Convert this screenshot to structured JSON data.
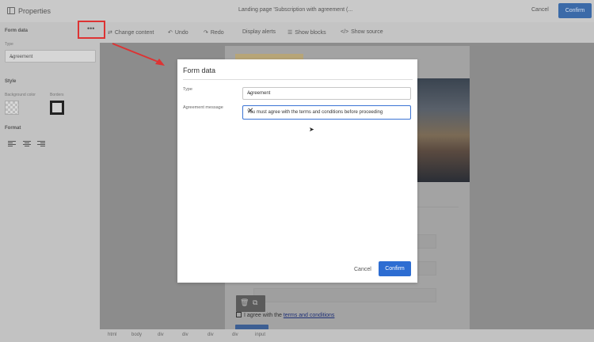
{
  "topbar": {
    "props_title": "Properties",
    "page_title": "Landing page 'Subscription with agreement (...",
    "cancel": "Cancel",
    "confirm": "Confirm"
  },
  "left_panel": {
    "form_data": "Form data",
    "type_label": "Type",
    "type_value": "Agreement",
    "style": "Style",
    "bg_color": "Background color",
    "borders": "Borders",
    "format": "Format"
  },
  "more_button": "•••",
  "toolbar": {
    "change_content": "Change content",
    "undo": "Undo",
    "redo": "Redo",
    "display_alerts": "Display alerts",
    "show_blocks": "Show blocks",
    "show_source": "Show source"
  },
  "page": {
    "agree_prefix": "I agree with the",
    "agree_link": "terms and conditions"
  },
  "breadcrumb": [
    "html",
    "body",
    "div",
    "div",
    "div",
    "div",
    "input"
  ],
  "modal": {
    "title": "Form data",
    "type_label": "Type",
    "type_value": "Agreement",
    "message_label": "Agreement message",
    "message_value": "You must agree with the terms and conditions before proceeding",
    "cancel": "Cancel",
    "confirm": "Confirm"
  },
  "icons": {
    "properties": "panel-icon",
    "change_content": "swap-icon",
    "undo": "undo-icon",
    "redo": "redo-icon",
    "show_blocks": "blocks-icon",
    "show_source": "code-icon",
    "clear": "close-icon",
    "chevron": "chevron-down-icon"
  },
  "colors": {
    "accent": "#2d6dd2",
    "annotation": "#dd3333"
  }
}
